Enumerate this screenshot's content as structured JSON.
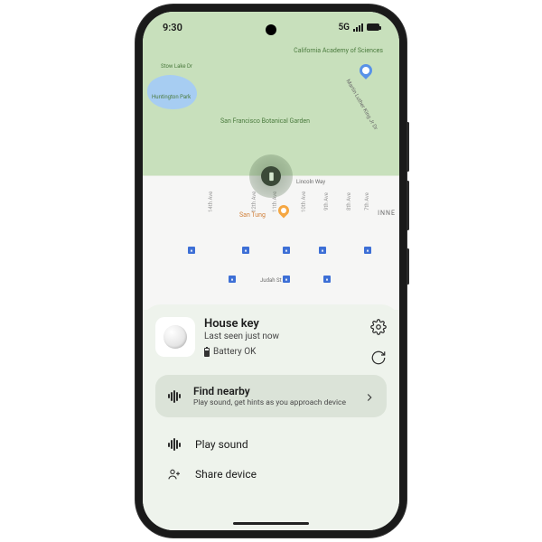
{
  "statusbar": {
    "time": "9:30",
    "network": "5G"
  },
  "map": {
    "labels": {
      "academy": "California Academy\nof Sciences",
      "garden": "San Francisco\nBotanical\nGarden",
      "lake": "Stow Lake Dr",
      "huntington": "Huntington\nPark",
      "lincoln": "Lincoln Way",
      "santung": "San Tung",
      "inner": "INNE",
      "judah": "Judah St",
      "mlk": "Martin Luther King Jr Dr",
      "avenues": [
        "7th Ave",
        "8th Ave",
        "9th Ave",
        "10th Ave",
        "11th Ave",
        "12th Ave",
        "14th Ave"
      ]
    }
  },
  "device": {
    "name": "House key",
    "last_seen": "Last seen just now",
    "battery": "Battery OK"
  },
  "find": {
    "title": "Find nearby",
    "subtitle": "Play sound, get hints as you approach device"
  },
  "actions": {
    "play_sound": "Play sound",
    "share_device": "Share device"
  }
}
